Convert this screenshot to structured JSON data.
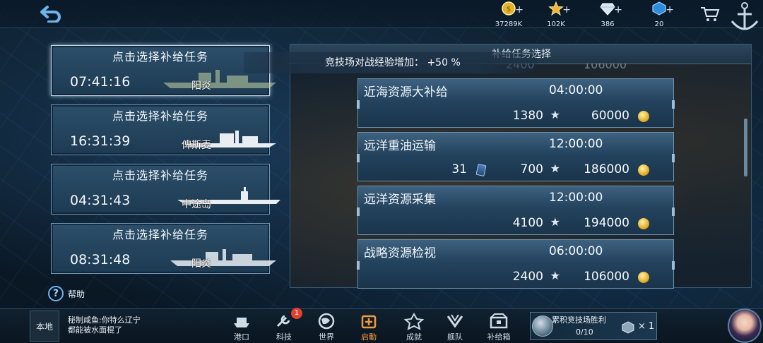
{
  "topbar": {
    "resources": [
      {
        "name": "gold",
        "value": "37289K"
      },
      {
        "name": "star",
        "value": "102K"
      },
      {
        "name": "diamond",
        "value": "386"
      },
      {
        "name": "gem",
        "value": "20"
      }
    ],
    "plus": "+"
  },
  "tasks": [
    {
      "title": "点击选择补给任务",
      "time": "07:41:16",
      "ship": "阳炎"
    },
    {
      "title": "点击选择补给任务",
      "time": "16:31:39",
      "ship": "俾斯麦"
    },
    {
      "title": "点击选择补给任务",
      "time": "04:31:43",
      "ship": "中途岛"
    },
    {
      "title": "点击选择补给任务",
      "time": "08:31:48",
      "ship": "阳炎"
    }
  ],
  "help": {
    "label": "帮助",
    "icon": "?"
  },
  "panel": {
    "title": "补给任务选择",
    "bonus": "竞技场对战经验增加： +50 %",
    "partial_top": {
      "time": "2400",
      "coin": "106000"
    },
    "missions": [
      {
        "name": "近海资源大补给",
        "time": "04:00:00",
        "ticket": "",
        "exp": "1380",
        "coin": "60000"
      },
      {
        "name": "远洋重油运输",
        "time": "12:00:00",
        "ticket": "31",
        "exp": "700",
        "coin": "186000"
      },
      {
        "name": "远洋资源采集",
        "time": "12:00:00",
        "ticket": "",
        "exp": "4100",
        "coin": "194000"
      },
      {
        "name": "战略资源检视",
        "time": "06:00:00",
        "ticket": "",
        "exp": "2400",
        "coin": "106000"
      }
    ],
    "star": "★"
  },
  "bottom": {
    "local": "本地",
    "chat_line1": "秘制咸鱼:你特么辽宁",
    "chat_line2": "都能被水面棍了",
    "badge": "1",
    "nav": [
      {
        "label": "港口"
      },
      {
        "label": "科技"
      },
      {
        "label": "世界"
      },
      {
        "label": "启動"
      },
      {
        "label": "成就"
      },
      {
        "label": "舰队"
      },
      {
        "label": "补给箱"
      }
    ],
    "arena": {
      "title": "累积竞技场胜利",
      "progress": "0/10",
      "count": "× 1"
    }
  }
}
